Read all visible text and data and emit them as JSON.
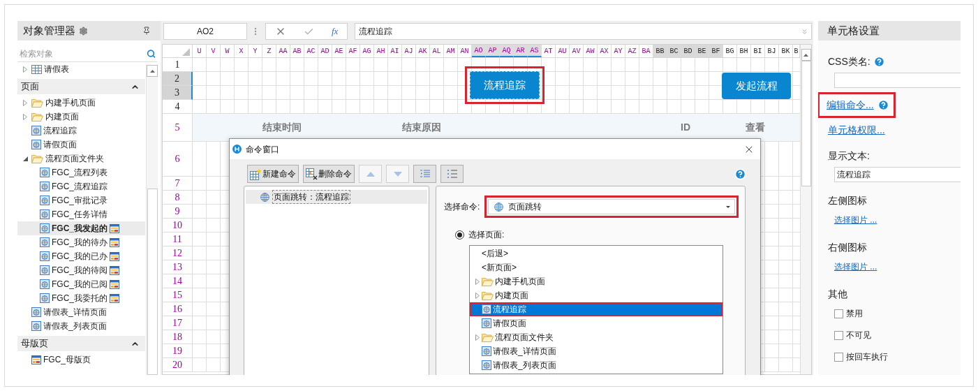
{
  "object_manager": {
    "title": "对象管理器",
    "search": {
      "placeholder": "检索对象"
    },
    "tables": [
      {
        "kind": "table",
        "label": "请假表",
        "expanded": false,
        "selected": false
      }
    ],
    "sections": [
      {
        "title": "页面",
        "expanded": true,
        "items": [
          {
            "kind": "folder",
            "label": "内建手机页面",
            "expanded": false,
            "selected": false
          },
          {
            "kind": "folder",
            "label": "内建页面",
            "expanded": false,
            "selected": false
          },
          {
            "kind": "page",
            "label": "流程追踪",
            "selected": false
          },
          {
            "kind": "page",
            "label": "请假页面",
            "selected": false
          },
          {
            "kind": "folder",
            "label": "流程页面文件夹",
            "expanded": true,
            "selected": false,
            "children": [
              {
                "kind": "page",
                "label": "FGC_流程列表",
                "selected": false,
                "badge": false
              },
              {
                "kind": "page",
                "label": "FGC_流程追踪",
                "selected": false,
                "badge": false
              },
              {
                "kind": "page",
                "label": "FGC_审批记录",
                "selected": false,
                "badge": false
              },
              {
                "kind": "page",
                "label": "FGC_任务详情",
                "selected": false,
                "badge": false
              },
              {
                "kind": "page",
                "label": "FGC_我发起的",
                "selected": true,
                "badge": true
              },
              {
                "kind": "page",
                "label": "FGC_我的待办",
                "selected": false,
                "badge": true
              },
              {
                "kind": "page",
                "label": "FGC_我的已办",
                "selected": false,
                "badge": true
              },
              {
                "kind": "page",
                "label": "FGC_我的待阅",
                "selected": false,
                "badge": true
              },
              {
                "kind": "page",
                "label": "FGC_我的已阅",
                "selected": false,
                "badge": true
              },
              {
                "kind": "page",
                "label": "FGC_我委托的",
                "selected": false,
                "badge": true
              }
            ]
          },
          {
            "kind": "page",
            "label": "请假表_详情页面",
            "selected": false
          },
          {
            "kind": "page",
            "label": "请假表_列表页面",
            "selected": false
          }
        ]
      },
      {
        "title": "母版页",
        "expanded": true,
        "items": [
          {
            "kind": "master",
            "label": "FGC_母版页",
            "selected": false
          }
        ]
      }
    ]
  },
  "formula_bar": {
    "cell_ref": "AO2",
    "function_symbol": "fx",
    "formula": "流程追踪"
  },
  "sheet": {
    "columns": [
      {
        "label": "U",
        "kind": "used",
        "selected": false
      },
      {
        "label": "V",
        "kind": "used",
        "selected": false
      },
      {
        "label": "W",
        "kind": "used",
        "selected": false
      },
      {
        "label": "X",
        "kind": "used",
        "selected": false
      },
      {
        "label": "Y",
        "kind": "used",
        "selected": false
      },
      {
        "label": "Z",
        "kind": "used",
        "selected": false
      },
      {
        "label": "AA",
        "kind": "used",
        "selected": false
      },
      {
        "label": "AB",
        "kind": "used",
        "selected": false
      },
      {
        "label": "AC",
        "kind": "used",
        "selected": false
      },
      {
        "label": "AD",
        "kind": "used",
        "selected": false
      },
      {
        "label": "AE",
        "kind": "used",
        "selected": false
      },
      {
        "label": "AF",
        "kind": "used",
        "selected": false
      },
      {
        "label": "AG",
        "kind": "used",
        "selected": false
      },
      {
        "label": "AH",
        "kind": "used",
        "selected": false
      },
      {
        "label": "AI",
        "kind": "used",
        "selected": false
      },
      {
        "label": "AJ",
        "kind": "used",
        "selected": false
      },
      {
        "label": "AK",
        "kind": "used",
        "selected": false
      },
      {
        "label": "AL",
        "kind": "used",
        "selected": false
      },
      {
        "label": "AM",
        "kind": "used",
        "selected": false
      },
      {
        "label": "AN",
        "kind": "used",
        "selected": false
      },
      {
        "label": "AO",
        "kind": "used",
        "selected": true
      },
      {
        "label": "AP",
        "kind": "used",
        "selected": true
      },
      {
        "label": "AQ",
        "kind": "used",
        "selected": true
      },
      {
        "label": "AR",
        "kind": "used",
        "selected": true
      },
      {
        "label": "AS",
        "kind": "used",
        "selected": true
      },
      {
        "label": "AT",
        "kind": "used",
        "selected": false
      },
      {
        "label": "AU",
        "kind": "used",
        "selected": false
      },
      {
        "label": "AV",
        "kind": "used",
        "selected": false
      },
      {
        "label": "AW",
        "kind": "used",
        "selected": false
      },
      {
        "label": "AX",
        "kind": "used",
        "selected": false
      },
      {
        "label": "AY",
        "kind": "used",
        "selected": false
      },
      {
        "label": "AZ",
        "kind": "used",
        "selected": false
      },
      {
        "label": "BA",
        "kind": "used",
        "selected": false
      },
      {
        "label": "BB",
        "kind": "hidden",
        "selected": false
      },
      {
        "label": "BC",
        "kind": "hidden",
        "selected": false
      },
      {
        "label": "BD",
        "kind": "hidden",
        "selected": false
      },
      {
        "label": "BE",
        "kind": "hidden",
        "selected": false
      },
      {
        "label": "BF",
        "kind": "hidden",
        "selected": false
      },
      {
        "label": "BG",
        "kind": "plain",
        "selected": false
      },
      {
        "label": "BH",
        "kind": "plain",
        "selected": false
      },
      {
        "label": "BI",
        "kind": "plain",
        "selected": false
      },
      {
        "label": "BJ",
        "kind": "plain",
        "selected": false
      },
      {
        "label": "BK",
        "kind": "plain",
        "selected": false
      },
      {
        "label": "B",
        "kind": "plain",
        "selected": false
      }
    ],
    "rows": [
      {
        "label": "1",
        "kind": "plain",
        "selected": false
      },
      {
        "label": "2",
        "kind": "plain",
        "selected": true
      },
      {
        "label": "3",
        "kind": "plain",
        "selected": true
      },
      {
        "label": "4",
        "kind": "plain",
        "selected": false
      },
      {
        "label": "5",
        "kind": "used",
        "selected": false
      },
      {
        "label": "6",
        "kind": "used",
        "selected": false
      },
      {
        "label": "7",
        "kind": "used",
        "selected": false
      },
      {
        "label": "8",
        "kind": "used",
        "selected": false
      },
      {
        "label": "9",
        "kind": "used",
        "selected": false
      },
      {
        "label": "10",
        "kind": "used",
        "selected": false
      },
      {
        "label": "11",
        "kind": "used",
        "selected": false
      },
      {
        "label": "12",
        "kind": "used",
        "selected": false
      },
      {
        "label": "13",
        "kind": "used",
        "selected": false
      },
      {
        "label": "14",
        "kind": "used",
        "selected": false
      },
      {
        "label": "15",
        "kind": "used",
        "selected": false
      },
      {
        "label": "16",
        "kind": "used",
        "selected": false
      },
      {
        "label": "17",
        "kind": "used",
        "selected": false
      },
      {
        "label": "18",
        "kind": "used",
        "selected": false
      },
      {
        "label": "19",
        "kind": "used",
        "selected": false
      },
      {
        "label": "20",
        "kind": "used",
        "selected": false
      }
    ],
    "buttons": [
      {
        "label": "流程追踪",
        "selected": true,
        "highlighted": true
      },
      {
        "label": "发起流程",
        "selected": false,
        "highlighted": false
      }
    ],
    "table_headers": [
      "结束时间",
      "结束原因",
      "ID",
      "查看"
    ]
  },
  "dialog": {
    "title": "命令窗口",
    "toolbar": [
      {
        "kind": "new",
        "label": "新建命令",
        "disabled": false
      },
      {
        "kind": "delete",
        "label": "删除命令",
        "disabled": false
      },
      {
        "kind": "up",
        "disabled": true
      },
      {
        "kind": "down",
        "disabled": true
      },
      {
        "kind": "indent",
        "disabled": false
      },
      {
        "kind": "outdent",
        "disabled": false
      }
    ],
    "commands": [
      {
        "label": "页面跳转：流程追踪",
        "selected": true
      }
    ],
    "select_command": {
      "label": "选择命令:",
      "value": "页面跳转",
      "highlighted": true
    },
    "page_choice": {
      "label": "选择页面:",
      "selected": true
    },
    "pages": [
      {
        "kind": "back",
        "label": "<后退>",
        "selected": false,
        "highlighted": false
      },
      {
        "kind": "new",
        "label": "<新页面>",
        "selected": false,
        "highlighted": false
      },
      {
        "kind": "folder",
        "label": "内建手机页面",
        "expanded": false,
        "selected": false,
        "highlighted": false
      },
      {
        "kind": "folder",
        "label": "内建页面",
        "expanded": false,
        "selected": false,
        "highlighted": false
      },
      {
        "kind": "page",
        "label": "流程追踪",
        "selected": true,
        "highlighted": true
      },
      {
        "kind": "page",
        "label": "请假页面",
        "selected": false,
        "highlighted": false
      },
      {
        "kind": "folder",
        "label": "流程页面文件夹",
        "expanded": false,
        "selected": false,
        "highlighted": false
      },
      {
        "kind": "page",
        "label": "请假表_详情页面",
        "selected": false,
        "highlighted": false
      },
      {
        "kind": "page",
        "label": "请假表_列表页面",
        "selected": false,
        "highlighted": false
      }
    ]
  },
  "settings": {
    "title": "单元格设置",
    "css_class": {
      "label": "CSS类名:"
    },
    "edit_command": {
      "label": "编辑命令...",
      "highlighted": true
    },
    "permissions": {
      "label": "单元格权限..."
    },
    "display_text": {
      "label": "显示文本:",
      "value": "流程追踪"
    },
    "left_icon": {
      "label": "左侧图标",
      "link": "选择图片 ..."
    },
    "right_icon": {
      "label": "右侧图标",
      "link": "选择图片 ..."
    },
    "other": {
      "label": "其他",
      "options": [
        {
          "label": "禁用",
          "checked": false
        },
        {
          "label": "不可见",
          "checked": false
        },
        {
          "label": "按回车执行",
          "checked": false
        }
      ]
    }
  }
}
